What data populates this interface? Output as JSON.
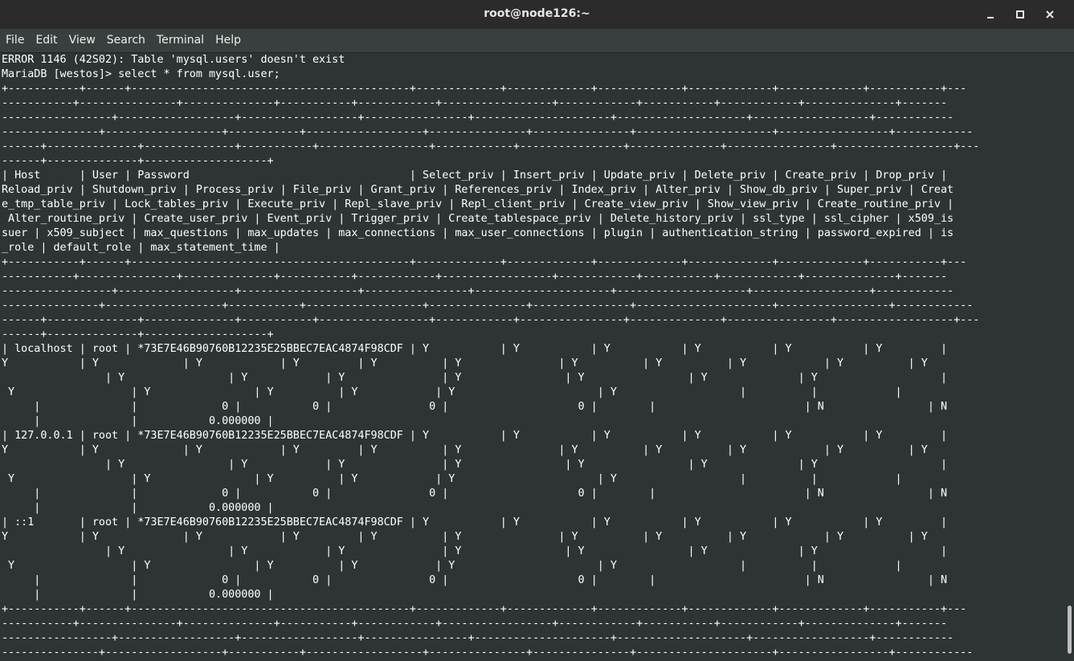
{
  "window": {
    "title": "root@node126:~",
    "controls": {
      "minimize": "minimize-icon",
      "maximize": "maximize-icon",
      "close": "close-icon"
    }
  },
  "menu": [
    {
      "label": "File"
    },
    {
      "label": "Edit"
    },
    {
      "label": "View"
    },
    {
      "label": "Search"
    },
    {
      "label": "Terminal"
    },
    {
      "label": "Help"
    }
  ],
  "terminal": {
    "lines": [
      "ERROR 1146 (42S02): Table 'mysql.users' doesn't exist",
      "MariaDB [westos]> select * from mysql.user;",
      "+-----------+------+-------------------------------------------+-------------+-------------+-------------+-------------+-------------+-----------+---",
      "-----------+---------------+--------------+-----------+------------+-----------------+------------+-----------+------------+--------------+-------",
      "-----------------+------------------+------------------+----------------+---------------------+--------------------+------------------+------------",
      "---------------+------------------+-----------+------------------+---------------+---------------+---------------------+-----------------+------------",
      "------+--------------+--------------+-----------+-----------------+------------+----------------+--------------+----------------+------------------+---",
      "------+--------------+-------------------+",
      "| Host      | User | Password                                  | Select_priv | Insert_priv | Update_priv | Delete_priv | Create_priv | Drop_priv |",
      "Reload_priv | Shutdown_priv | Process_priv | File_priv | Grant_priv | References_priv | Index_priv | Alter_priv | Show_db_priv | Super_priv | Creat",
      "e_tmp_table_priv | Lock_tables_priv | Execute_priv | Repl_slave_priv | Repl_client_priv | Create_view_priv | Show_view_priv | Create_routine_priv |",
      " Alter_routine_priv | Create_user_priv | Event_priv | Trigger_priv | Create_tablespace_priv | Delete_history_priv | ssl_type | ssl_cipher | x509_is",
      "suer | x509_subject | max_questions | max_updates | max_connections | max_user_connections | plugin | authentication_string | password_expired | is",
      "_role | default_role | max_statement_time |",
      "+-----------+------+-------------------------------------------+-------------+-------------+-------------+-------------+-------------+-----------+---",
      "-----------+---------------+--------------+-----------+------------+-----------------+------------+-----------+------------+--------------+-------",
      "-----------------+------------------+------------------+----------------+---------------------+--------------------+------------------+------------",
      "---------------+------------------+-----------+------------------+---------------+---------------+---------------------+-----------------+------------",
      "------+--------------+--------------+-----------+-----------------+------------+----------------+--------------+----------------+------------------+---",
      "------+--------------+-------------------+",
      "| localhost | root | *73E7E46B90760B12235E25BBEC7EAC4874F98CDF | Y           | Y           | Y           | Y           | Y           | Y         |",
      "Y           | Y             | Y            | Y         | Y          | Y               | Y          | Y          | Y            | Y          | Y",
      "                | Y                | Y            | Y               | Y                | Y                | Y              | Y                   |",
      " Y                  | Y                | Y          | Y            | Y                      | Y                   |          |            |",
      "     |              |             0 |           0 |               0 |                    0 |        |                       | N                | N",
      "     |              |           0.000000 |",
      "| 127.0.0.1 | root | *73E7E46B90760B12235E25BBEC7EAC4874F98CDF | Y           | Y           | Y           | Y           | Y           | Y         |",
      "Y           | Y             | Y            | Y         | Y          | Y               | Y          | Y          | Y            | Y          | Y",
      "                | Y                | Y            | Y               | Y                | Y                | Y              | Y                   |",
      " Y                  | Y                | Y          | Y            | Y                      | Y                   |          |            |",
      "     |              |             0 |           0 |               0 |                    0 |        |                       | N                | N",
      "     |              |           0.000000 |",
      "| ::1       | root | *73E7E46B90760B12235E25BBEC7EAC4874F98CDF | Y           | Y           | Y           | Y           | Y           | Y         |",
      "Y           | Y             | Y            | Y         | Y          | Y               | Y          | Y          | Y            | Y          | Y",
      "                | Y                | Y            | Y               | Y                | Y                | Y              | Y                   |",
      " Y                  | Y                | Y          | Y            | Y                      | Y                   |          |            |",
      "     |              |             0 |           0 |               0 |                    0 |        |                       | N                | N",
      "     |              |           0.000000 |",
      "+-----------+------+-------------------------------------------+-------------+-------------+-------------+-------------+-------------+-----------+---",
      "-----------+---------------+--------------+-----------+------------+-----------------+------------+-----------+------------+--------------+-------",
      "-----------------+------------------+------------------+----------------+---------------------+--------------------+------------------+------------",
      "---------------+------------------+-----------+------------------+---------------+---------------+---------------------+-----------------+------------"
    ]
  }
}
